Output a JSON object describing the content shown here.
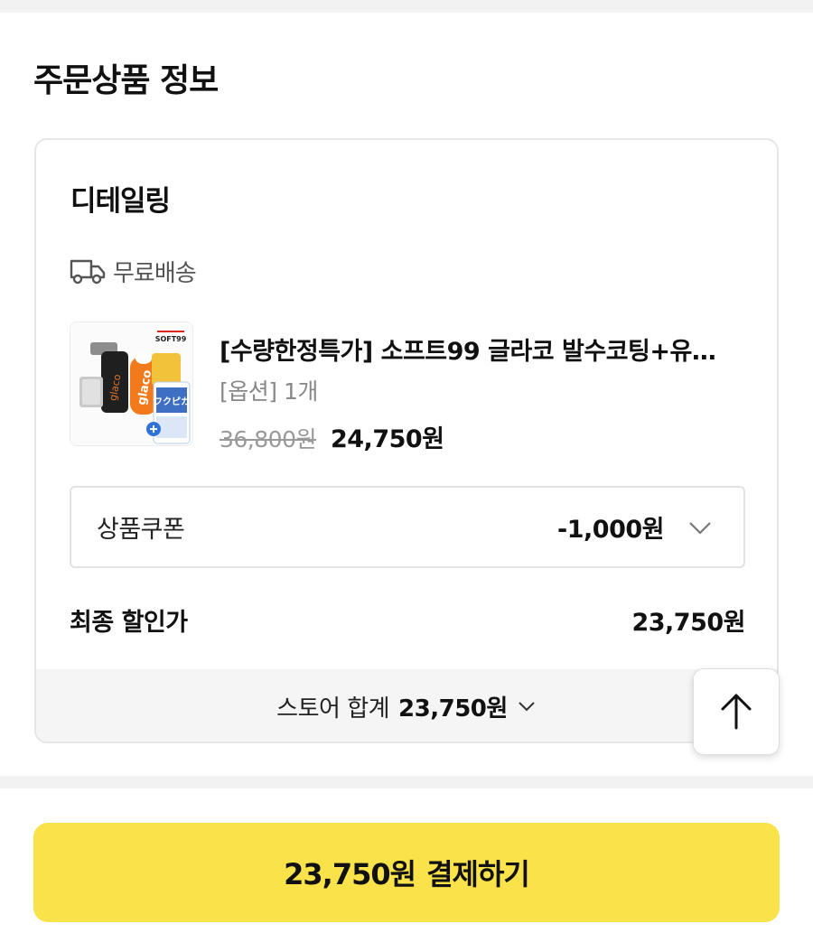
{
  "order": {
    "section_title": "주문상품 정보"
  },
  "store": {
    "name": "디테일링",
    "shipping_label": "무료배송",
    "shipping_icon": "truck-icon",
    "total_label": "스토어 합계",
    "total_value": "23,750원"
  },
  "product": {
    "name": "[수량한정특가] 소프트99 글라코 발수코팅+유…",
    "option": "[옵션] 1개",
    "original_price": "36,800원",
    "sale_price": "24,750원",
    "thumb_brand": "SOFT99",
    "thumb_product": "glaco"
  },
  "coupon": {
    "label": "상품쿠폰",
    "value": "-1,000원"
  },
  "final": {
    "label": "최종 할인가",
    "value": "23,750원"
  },
  "pay_button": {
    "amount": "23,750원",
    "label": "결제하기"
  },
  "colors": {
    "pay_button_bg": "#fae34a",
    "store_total_bar_bg": "#f5f5f5",
    "muted_text": "#888888"
  }
}
